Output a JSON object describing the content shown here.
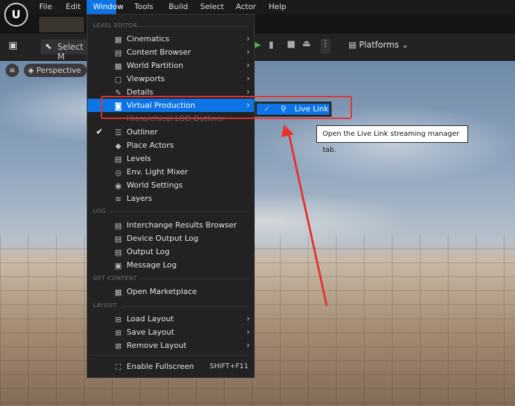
{
  "menubar": {
    "items": [
      "File",
      "Edit",
      "Window",
      "Tools",
      "Build",
      "Select",
      "Actor",
      "Help"
    ],
    "active": "Window"
  },
  "toolbar": {
    "select_label": "Select M",
    "platforms_label": "Platforms"
  },
  "viewport": {
    "perspective_label": "Perspective"
  },
  "window_menu": {
    "sections": {
      "level_editor": "LEVEL EDITOR",
      "log": "LOG",
      "get_content": "GET CONTENT",
      "layout": "LAYOUT"
    },
    "items": {
      "cinematics": "Cinematics",
      "content_browser": "Content Browser",
      "world_partition": "World Partition",
      "viewports": "Viewports",
      "details": "Details",
      "virtual_production": "Virtual Production",
      "hlod_outliner": "Hierarchical LOD Outliner",
      "outliner": "Outliner",
      "place_actors": "Place Actors",
      "levels": "Levels",
      "env_light_mixer": "Env. Light Mixer",
      "world_settings": "World Settings",
      "layers": "Layers",
      "interchange_results": "Interchange Results Browser",
      "device_output_log": "Device Output Log",
      "output_log": "Output Log",
      "message_log": "Message Log",
      "open_marketplace": "Open Marketplace",
      "load_layout": "Load Layout",
      "save_layout": "Save Layout",
      "remove_layout": "Remove Layout",
      "enable_fullscreen": "Enable Fullscreen",
      "fullscreen_shortcut": "SHIFT+F11"
    }
  },
  "submenu": {
    "live_link": "Live Link"
  },
  "tooltip": {
    "text": "Open the Live Link streaming manager tab."
  },
  "colors": {
    "highlight": "#0d74e6",
    "annotation_red": "#e4322d",
    "menu_bg": "#222222"
  }
}
